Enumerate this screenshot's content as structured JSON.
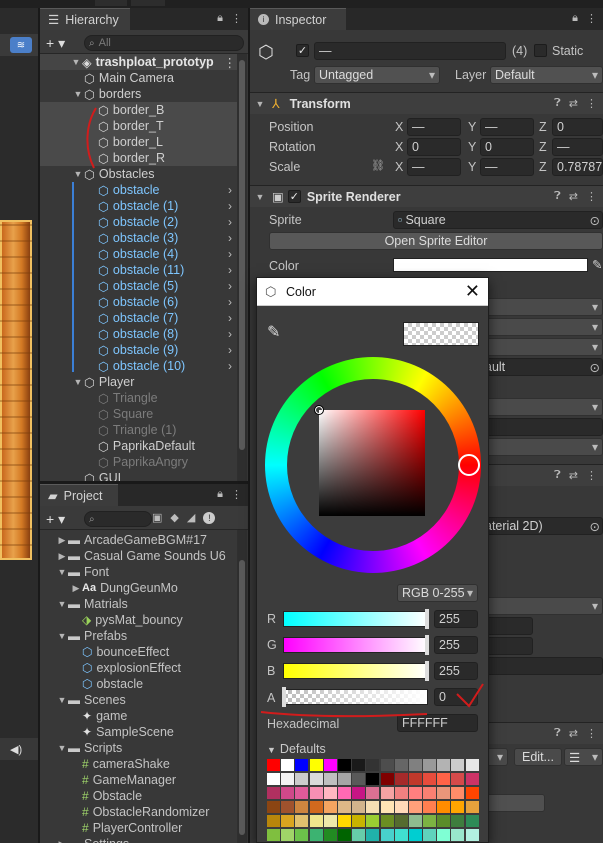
{
  "hierarchy": {
    "tab": "Hierarchy",
    "search_placeholder": "All",
    "root": "trashploat_prototyp",
    "items": [
      {
        "label": "Main Camera",
        "depth": 1,
        "style": "normal",
        "arrow": ""
      },
      {
        "label": "borders",
        "depth": 1,
        "style": "normal",
        "arrow": "▼"
      },
      {
        "label": "border_B",
        "depth": 2,
        "style": "sel",
        "arrow": ""
      },
      {
        "label": "border_T",
        "depth": 2,
        "style": "sel",
        "arrow": ""
      },
      {
        "label": "border_L",
        "depth": 2,
        "style": "sel",
        "arrow": ""
      },
      {
        "label": "border_R",
        "depth": 2,
        "style": "sel",
        "arrow": ""
      },
      {
        "label": "Obstacles",
        "depth": 1,
        "style": "normal",
        "arrow": "▼"
      },
      {
        "label": "obstacle",
        "depth": 2,
        "style": "blue",
        "arrow": ""
      },
      {
        "label": "obstacle (1)",
        "depth": 2,
        "style": "blue",
        "arrow": ""
      },
      {
        "label": "obstacle (2)",
        "depth": 2,
        "style": "blue",
        "arrow": ""
      },
      {
        "label": "obstacle (3)",
        "depth": 2,
        "style": "blue",
        "arrow": ""
      },
      {
        "label": "obstacle (4)",
        "depth": 2,
        "style": "blue",
        "arrow": ""
      },
      {
        "label": "obstacle (11)",
        "depth": 2,
        "style": "blue",
        "arrow": ""
      },
      {
        "label": "obstacle (5)",
        "depth": 2,
        "style": "blue",
        "arrow": ""
      },
      {
        "label": "obstacle (6)",
        "depth": 2,
        "style": "blue",
        "arrow": ""
      },
      {
        "label": "obstacle (7)",
        "depth": 2,
        "style": "blue",
        "arrow": ""
      },
      {
        "label": "obstacle (8)",
        "depth": 2,
        "style": "blue",
        "arrow": ""
      },
      {
        "label": "obstacle (9)",
        "depth": 2,
        "style": "blue",
        "arrow": ""
      },
      {
        "label": "obstacle (10)",
        "depth": 2,
        "style": "blue",
        "arrow": ""
      },
      {
        "label": "Player",
        "depth": 1,
        "style": "normal",
        "arrow": "▼"
      },
      {
        "label": "Triangle",
        "depth": 2,
        "style": "dim",
        "arrow": ""
      },
      {
        "label": "Square",
        "depth": 2,
        "style": "dim",
        "arrow": ""
      },
      {
        "label": "Triangle (1)",
        "depth": 2,
        "style": "dim",
        "arrow": ""
      },
      {
        "label": "PaprikaDefault",
        "depth": 2,
        "style": "normal",
        "arrow": ""
      },
      {
        "label": "PaprikaAngry",
        "depth": 2,
        "style": "dim",
        "arrow": ""
      },
      {
        "label": "GUI",
        "depth": 1,
        "style": "normal",
        "arrow": ""
      }
    ]
  },
  "project": {
    "tab": "Project",
    "items": [
      {
        "label": "ArcadeGameBGM#17",
        "depth": 0,
        "type": "folder",
        "arrow": "▶"
      },
      {
        "label": "Casual Game Sounds U6",
        "depth": 0,
        "type": "folder",
        "arrow": "▶"
      },
      {
        "label": "Font",
        "depth": 0,
        "type": "folder",
        "arrow": "▼"
      },
      {
        "label": "DungGeunMo",
        "depth": 1,
        "type": "font",
        "arrow": "▶"
      },
      {
        "label": "Matrials",
        "depth": 0,
        "type": "folder",
        "arrow": "▼"
      },
      {
        "label": "pysMat_bouncy",
        "depth": 1,
        "type": "physmat",
        "arrow": ""
      },
      {
        "label": "Prefabs",
        "depth": 0,
        "type": "folder",
        "arrow": "▼"
      },
      {
        "label": "bounceEffect",
        "depth": 1,
        "type": "prefab",
        "arrow": ""
      },
      {
        "label": "explosionEffect",
        "depth": 1,
        "type": "prefab",
        "arrow": ""
      },
      {
        "label": "obstacle",
        "depth": 1,
        "type": "prefab",
        "arrow": ""
      },
      {
        "label": "Scenes",
        "depth": 0,
        "type": "folder",
        "arrow": "▼"
      },
      {
        "label": "game",
        "depth": 1,
        "type": "scene",
        "arrow": ""
      },
      {
        "label": "SampleScene",
        "depth": 1,
        "type": "scene",
        "arrow": ""
      },
      {
        "label": "Scripts",
        "depth": 0,
        "type": "folder",
        "arrow": "▼"
      },
      {
        "label": "cameraShake",
        "depth": 1,
        "type": "script",
        "arrow": ""
      },
      {
        "label": "GameManager",
        "depth": 1,
        "type": "script",
        "arrow": ""
      },
      {
        "label": "Obstacle",
        "depth": 1,
        "type": "script",
        "arrow": ""
      },
      {
        "label": "ObstacleRandomizer",
        "depth": 1,
        "type": "script",
        "arrow": ""
      },
      {
        "label": "PlayerController",
        "depth": 1,
        "type": "script",
        "arrow": ""
      },
      {
        "label": "Settings",
        "depth": 0,
        "type": "folder",
        "arrow": "▶"
      }
    ]
  },
  "inspector": {
    "tab": "Inspector",
    "name_value": "—",
    "count": "(4)",
    "static_label": "Static",
    "tag_label": "Tag",
    "tag_value": "Untagged",
    "layer_label": "Layer",
    "layer_value": "Default",
    "transform": {
      "title": "Transform",
      "position": {
        "label": "Position",
        "x": "—",
        "y": "—",
        "z": "0"
      },
      "rotation": {
        "label": "Rotation",
        "x": "0",
        "y": "0",
        "z": "—"
      },
      "scale": {
        "label": "Scale",
        "x": "—",
        "y": "—",
        "z": "0.78787"
      }
    },
    "sprite_renderer": {
      "title": "Sprite Renderer",
      "sprite_label": "Sprite",
      "sprite_value": "Square",
      "open_editor": "Open Sprite Editor",
      "color_label": "Color",
      "partial_default": "ault",
      "partial_material": "aterial 2D)",
      "edit_label": "Edit..."
    }
  },
  "color_picker": {
    "title": "Color",
    "mode": "RGB 0-255",
    "r": {
      "label": "R",
      "value": "255"
    },
    "g": {
      "label": "G",
      "value": "255"
    },
    "b": {
      "label": "B",
      "value": "255"
    },
    "a": {
      "label": "A",
      "value": "0"
    },
    "hex_label": "Hexadecimal",
    "hex_value": "FFFFFF",
    "defaults_label": "Defaults",
    "swatches": [
      "#ff0000",
      "#ffffff",
      "#0000ff",
      "#ffff00",
      "#ff00ff",
      "#000000",
      "#1a1a1a",
      "#333333",
      "#4d4d4d",
      "#666666",
      "#808080",
      "#999999",
      "#b3b3b3",
      "#cccccc",
      "#e6e6e6",
      "#ffffff",
      "#f2f2f2",
      "#cccccc",
      "#d9d9d9",
      "#bfbfbf",
      "#a6a6a6",
      "#595959",
      "#000000",
      "#7f0000",
      "#a52a2a",
      "#c0392b",
      "#e74c3c",
      "#ff6347",
      "#d64a4a",
      "#cc3366",
      "#b03060",
      "#d0488a",
      "#e05a9a",
      "#f78fb3",
      "#ffb6c1",
      "#ff69b4",
      "#c71585",
      "#db7093",
      "#f5a3a3",
      "#f08080",
      "#ff7f7f",
      "#fa8072",
      "#e9967a",
      "#ff8c69",
      "#ff4500",
      "#8b4513",
      "#a0522d",
      "#cd853f",
      "#d2691e",
      "#f4a460",
      "#deb887",
      "#d2b48c",
      "#f5deb3",
      "#ffe4b5",
      "#ffdab9",
      "#ffa07a",
      "#ff7f50",
      "#ff8c00",
      "#ffa500",
      "#e6a23c",
      "#b8860b",
      "#daa520",
      "#e1c16e",
      "#f0e68c",
      "#eee8aa",
      "#ffd700",
      "#c8b400",
      "#9acd32",
      "#6b8e23",
      "#556b2f",
      "#8fbc8f",
      "#7cb342",
      "#5b8c2a",
      "#3e7d3e",
      "#2e8b57",
      "#7fbf3f",
      "#a0d468",
      "#6cc24a",
      "#3cb371",
      "#228b22",
      "#006400",
      "#66cdaa",
      "#20b2aa",
      "#48d1cc",
      "#40e0d0",
      "#00ced1",
      "#5fd3bc",
      "#7fffd4",
      "#99e6cc",
      "#b2f0e0"
    ]
  }
}
